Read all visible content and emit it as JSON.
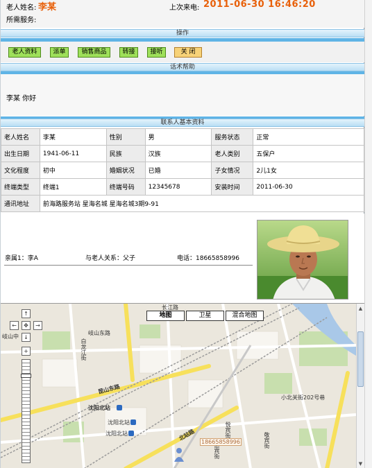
{
  "header": {
    "elder_name_label": "老人姓名:",
    "elder_name_value": "李某",
    "last_call_label": "上次来电:",
    "last_call_value": "2011-06-30 16:46:20",
    "service_label": "所需服务:"
  },
  "sections": {
    "operations": "操作",
    "script_help": "话术帮助",
    "contact_info": "联系人基本资料"
  },
  "buttons": {
    "elder_info": "老人资料",
    "dispatch": "派单",
    "sell_goods": "销售商品",
    "transfer": "转接",
    "answer": "接听",
    "close": "关 闭"
  },
  "help_text": "李某 你好",
  "info": {
    "name_label": "老人姓名",
    "name_value": "李某",
    "gender_label": "性别",
    "gender_value": "男",
    "status_label": "服务状态",
    "status_value": "正常",
    "birth_label": "出生日期",
    "birth_value": "1941-06-11",
    "ethnic_label": "民族",
    "ethnic_value": "汉族",
    "type_label": "老人类别",
    "type_value": "五保户",
    "edu_label": "文化程度",
    "edu_value": "初中",
    "marriage_label": "婚姻状况",
    "marriage_value": "已婚",
    "children_label": "子女情况",
    "children_value": "2儿1女",
    "terminal_type_label": "终端类型",
    "terminal_type_value": "终端1",
    "terminal_no_label": "终端号码",
    "terminal_no_value": "12345678",
    "install_label": "安装时间",
    "install_value": "2011-06-30",
    "address_label": "通讯地址",
    "address_value": "前海路服务站 星海名城 星海名城3期9-91"
  },
  "relative": {
    "relative_text": "亲属1：李A",
    "relation_text": "与老人关系：父子",
    "phone_text": "电话：18665858996"
  },
  "map": {
    "tabs": [
      "地图",
      "卫星",
      "混合地图"
    ],
    "labels": {
      "l1": "岐山东路",
      "l2": "昆山东路",
      "l3": "沈阳北站",
      "l4": "沈阳北站",
      "l5": "沈阳北站",
      "l6": "北站路",
      "l7": "小北关街202号巷",
      "l8": "岐山中",
      "l9": "白龙江街",
      "l10": "敬宾街",
      "l11": "长江路",
      "l12": "悦宾街",
      "l13": "惠宾街"
    },
    "phone_marker": "18665858996"
  }
}
